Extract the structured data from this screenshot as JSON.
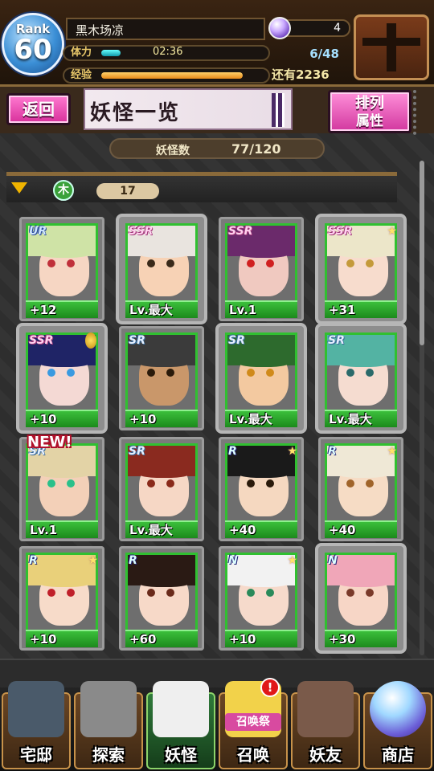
{
  "header": {
    "rank_label": "Rank",
    "rank_value": "60",
    "player_name": "黑木场凉",
    "stamina_label": "体力",
    "stamina_timer": "02:36",
    "stamina_fraction": 0.12,
    "exp_label": "经验",
    "exp_fraction": 0.88,
    "gem_count": "4",
    "stamina_count": "6/48",
    "remaining": "还有2236"
  },
  "title": {
    "back_label": "返回",
    "page_title": "妖怪一览",
    "sort_label_1": "排列",
    "sort_label_2": "属性"
  },
  "count": {
    "label": "妖怪数",
    "value": "77/120"
  },
  "filter": {
    "attribute_glyph": "木",
    "level": "17"
  },
  "cards": [
    {
      "rarity": "UR",
      "level": "+12",
      "hair": "#cfe3a6",
      "skin": "#f6d6c3",
      "eye": "#c0303a",
      "selected": false
    },
    {
      "rarity": "SSR",
      "level": "Lv.最大",
      "hair": "#e9e4df",
      "skin": "#f7d2b5",
      "eye": "#3a2a1a",
      "selected": true
    },
    {
      "rarity": "SSR",
      "level": "Lv.1",
      "hair": "#6b2a6b",
      "skin": "#f0c9c0",
      "eye": "#d02020",
      "selected": false
    },
    {
      "rarity": "SSR",
      "level": "+31",
      "hair": "#ece6c9",
      "skin": "#f7dccd",
      "eye": "#c49a3a",
      "selected": true,
      "star": true
    },
    {
      "rarity": "SSR",
      "level": "+10",
      "hair": "#1f2466",
      "skin": "#f4d9d4",
      "eye": "#3a9ae0",
      "selected": true,
      "medal": true
    },
    {
      "rarity": "SR",
      "level": "+10",
      "hair": "#3b3b3b",
      "skin": "#c9976a",
      "eye": "#2a1a0a",
      "selected": false
    },
    {
      "rarity": "SR",
      "level": "Lv.最大",
      "hair": "#2d6a2d",
      "skin": "#f3c9a0",
      "eye": "#d08a1a",
      "selected": true
    },
    {
      "rarity": "SR",
      "level": "Lv.最大",
      "hair": "#53b3a3",
      "skin": "#f5dcd0",
      "eye": "#2a6a6a",
      "selected": true
    },
    {
      "rarity": "SR",
      "level": "Lv.1",
      "hair": "#e3d3a6",
      "skin": "#f3d0b8",
      "eye": "#2ac08a",
      "selected": false,
      "new": true
    },
    {
      "rarity": "SR",
      "level": "Lv.最大",
      "hair": "#8a2a1f",
      "skin": "#f6d7c5",
      "eye": "#8a2a1a",
      "selected": false
    },
    {
      "rarity": "R",
      "level": "+40",
      "hair": "#1a1a1a",
      "skin": "#f5d8c0",
      "eye": "#2a1a0a",
      "selected": false,
      "star": true
    },
    {
      "rarity": "R",
      "level": "+40",
      "hair": "#efe8d6",
      "skin": "#f6dcc5",
      "eye": "#a0642a",
      "selected": false,
      "star": true
    },
    {
      "rarity": "R",
      "level": "+10",
      "hair": "#e9d07a",
      "skin": "#f7dbc9",
      "eye": "#c0202a",
      "selected": false,
      "star": true
    },
    {
      "rarity": "R",
      "level": "+60",
      "hair": "#2a1a14",
      "skin": "#f7d9c8",
      "eye": "#6a2a1a",
      "selected": false
    },
    {
      "rarity": "N",
      "level": "+10",
      "hair": "#f2f2f2",
      "skin": "#f6dacb",
      "eye": "#2a8a5a",
      "selected": false,
      "star": true
    },
    {
      "rarity": "N",
      "level": "+30",
      "hair": "#f0a6b8",
      "skin": "#f7d6c6",
      "eye": "#7a3a2a",
      "selected": true
    }
  ],
  "nav": [
    {
      "label": "宅邸"
    },
    {
      "label": "探索"
    },
    {
      "label": "妖怪",
      "active": true
    },
    {
      "label": "召唤",
      "sub": "召唤祭",
      "alert": "!"
    },
    {
      "label": "妖友"
    },
    {
      "label": "商店"
    }
  ],
  "colors": {
    "accent_pink": "#d8309b",
    "card_border": "#30c030",
    "level_green": "#1c8a1c"
  }
}
